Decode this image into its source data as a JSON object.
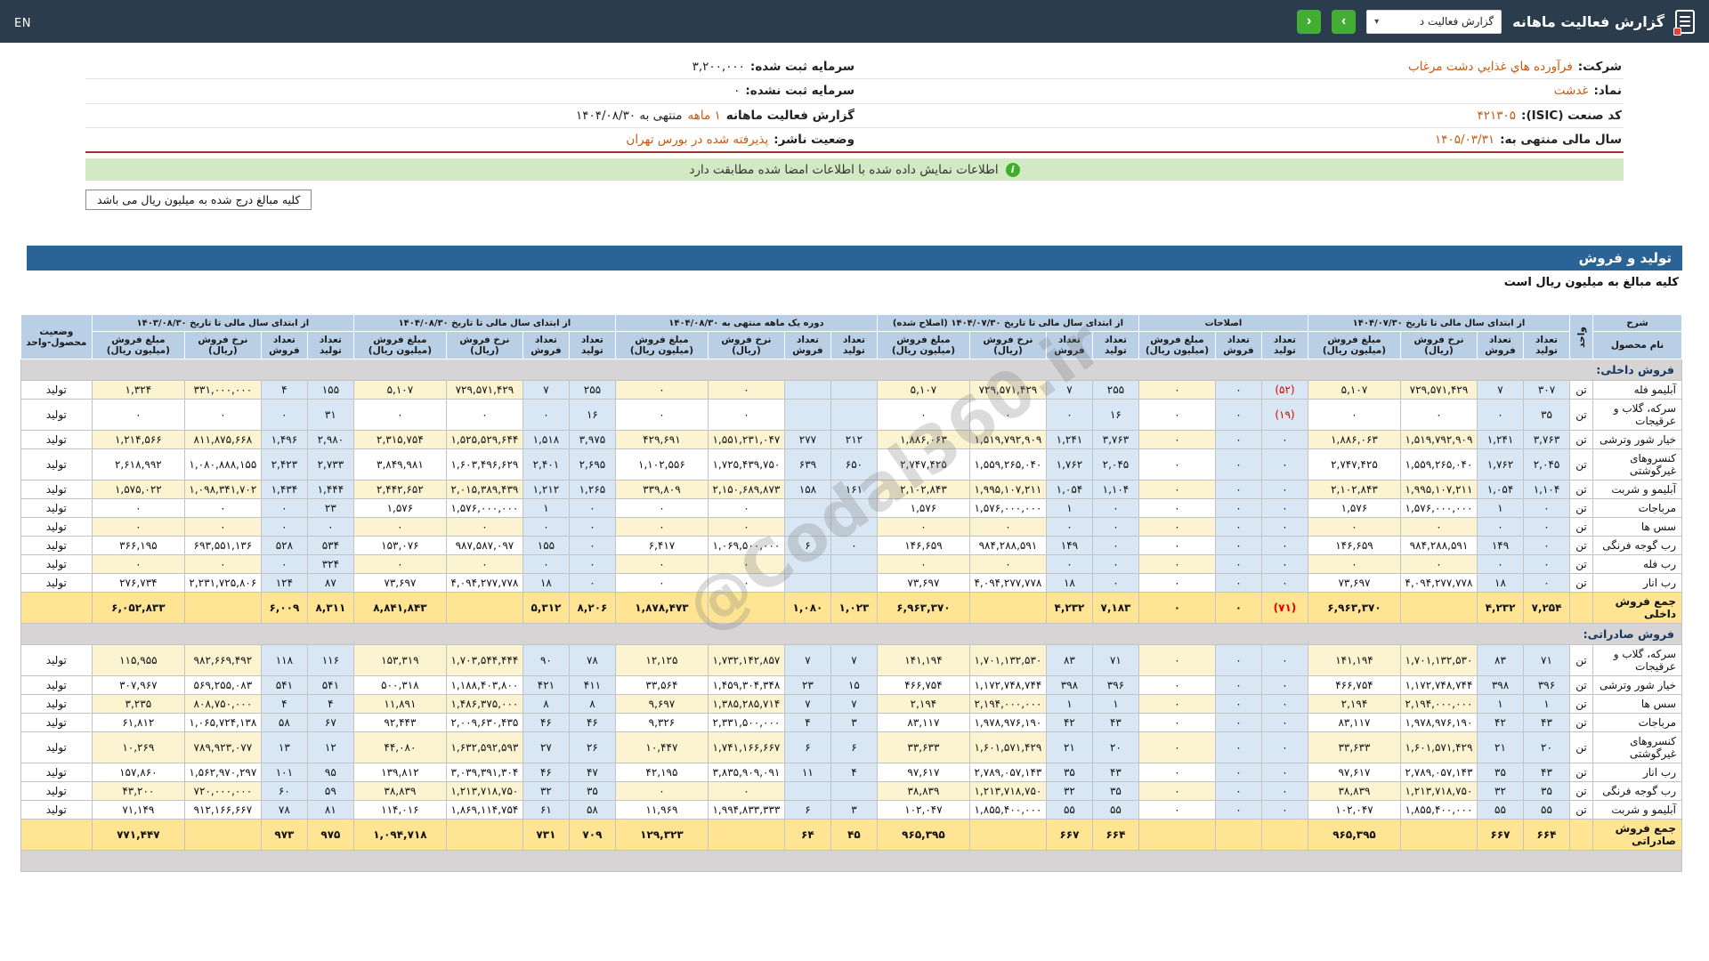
{
  "topbar": {
    "title": "گزارش فعالیت ماهانه",
    "dropdown_value": "گزارش فعالیت د",
    "next_label": "›",
    "prev_label": "‹",
    "lang_label": "EN"
  },
  "info": {
    "company_label": "شرکت:",
    "company": "فرآورده هاي غذايي دشت مرغاب",
    "symbol_label": "نماد:",
    "symbol": "غدشت",
    "isic_label": "کد صنعت (ISIC):",
    "isic": "۴۲۱۳۰۵",
    "fiscal_label": "سال مالی منتهی به:",
    "fiscal": "۱۴۰۵/۰۳/۳۱",
    "capital_reg_label": "سرمایه ثبت شده:",
    "capital_reg": "۳,۲۰۰,۰۰۰",
    "capital_unreg_label": "سرمایه ثبت نشده:",
    "capital_unreg": "۰",
    "report_label": "گزارش فعالیت ماهانه",
    "report_period": "۱ ماهه",
    "report_suffix": "منتهی به ۱۴۰۴/۰۸/۳۰",
    "issuer_label": "وضعیت ناشر:",
    "issuer": "پذیرفته شده در بورس تهران"
  },
  "banner": {
    "text": "اطلاعات نمایش داده شده با اطلاعات امضا شده مطابقت دارد"
  },
  "note": {
    "text": "کلیه مبالغ درج شده به میلیون ریال می باشد"
  },
  "watermark": "@Codal360.ir",
  "table": {
    "title": "تولید و فروش",
    "subtitle": "کلیه مبالغ به میلیون ریال است",
    "header": {
      "desc": "شرح",
      "product": "نام محصول",
      "unit": "واحد",
      "status": "وضعیت محصول-واحد",
      "count_produced": "تعداد تولید",
      "count_sold": "تعداد فروش",
      "rate": "نرخ فروش (ریال)",
      "amount": "مبلغ فروش (میلیون ریال)",
      "groups": [
        {
          "key": "g1",
          "label": "از ابتدای سال مالی تا تاریخ ۱۴۰۴/۰۷/۳۰",
          "cols": 4
        },
        {
          "key": "adj",
          "label": "اصلاحات",
          "cols": 3
        },
        {
          "key": "g3",
          "label": "از ابتدای سال مالی تا تاریخ ۱۴۰۴/۰۷/۳۰ (اصلاح شده)",
          "cols": 4
        },
        {
          "key": "g4",
          "label": "دوره یک ماهه منتهی به ۱۴۰۴/۰۸/۳۰",
          "cols": 4
        },
        {
          "key": "g5",
          "label": "از ابتدای سال مالی تا تاریخ ۱۴۰۴/۰۸/۳۰",
          "cols": 4
        },
        {
          "key": "g6",
          "label": "از ابتدای سال مالی تا تاریخ ۱۴۰۳/۰۸/۳۰",
          "cols": 4
        }
      ]
    },
    "rows": [
      {
        "type": "section",
        "name": "فروش داخلی:"
      },
      {
        "type": "data",
        "name": "آبلیمو فله",
        "unit": "تن",
        "status": "تولید",
        "g1": [
          "۳۰۷",
          "۷",
          "۷۲۹,۵۷۱,۴۲۹",
          "۵,۱۰۷"
        ],
        "adj": [
          "(۵۲)",
          "۰",
          "۰"
        ],
        "g3": [
          "۲۵۵",
          "۷",
          "۷۲۹,۵۷۱,۴۲۹",
          "۵,۱۰۷"
        ],
        "g4": [
          "",
          "",
          "۰",
          "۰"
        ],
        "g5": [
          "۲۵۵",
          "۷",
          "۷۲۹,۵۷۱,۴۲۹",
          "۵,۱۰۷"
        ],
        "g6": [
          "۱۵۵",
          "۴",
          "۳۳۱,۰۰۰,۰۰۰",
          "۱,۳۲۴"
        ]
      },
      {
        "type": "data",
        "name": "سرکه، گلاب و عرقیجات",
        "unit": "تن",
        "status": "تولید",
        "g1": [
          "۳۵",
          "۰",
          "۰",
          "۰"
        ],
        "adj": [
          "(۱۹)",
          "۰",
          "۰"
        ],
        "g3": [
          "۱۶",
          "۰",
          "۰",
          "۰"
        ],
        "g4": [
          "",
          "",
          "۰",
          "۰"
        ],
        "g5": [
          "۱۶",
          "۰",
          "۰",
          "۰"
        ],
        "g6": [
          "۳۱",
          "۰",
          "۰",
          "۰"
        ]
      },
      {
        "type": "data",
        "name": "خیار شور وترشی",
        "unit": "تن",
        "status": "تولید",
        "g1": [
          "۳,۷۶۳",
          "۱,۲۴۱",
          "۱,۵۱۹,۷۹۲,۹۰۹",
          "۱,۸۸۶,۰۶۳"
        ],
        "adj": [
          "۰",
          "۰",
          "۰"
        ],
        "g3": [
          "۳,۷۶۳",
          "۱,۲۴۱",
          "۱,۵۱۹,۷۹۲,۹۰۹",
          "۱,۸۸۶,۰۶۳"
        ],
        "g4": [
          "۲۱۲",
          "۲۷۷",
          "۱,۵۵۱,۲۳۱,۰۴۷",
          "۴۲۹,۶۹۱"
        ],
        "g5": [
          "۳,۹۷۵",
          "۱,۵۱۸",
          "۱,۵۲۵,۵۲۹,۶۴۴",
          "۲,۳۱۵,۷۵۴"
        ],
        "g6": [
          "۲,۹۸۰",
          "۱,۴۹۶",
          "۸۱۱,۸۷۵,۶۶۸",
          "۱,۲۱۴,۵۶۶"
        ]
      },
      {
        "type": "data",
        "name": "کنسروهای غیرگوشتی",
        "unit": "تن",
        "status": "تولید",
        "g1": [
          "۲,۰۴۵",
          "۱,۷۶۲",
          "۱,۵۵۹,۲۶۵,۰۴۰",
          "۲,۷۴۷,۴۲۵"
        ],
        "adj": [
          "۰",
          "۰",
          "۰"
        ],
        "g3": [
          "۲,۰۴۵",
          "۱,۷۶۲",
          "۱,۵۵۹,۲۶۵,۰۴۰",
          "۲,۷۴۷,۴۲۵"
        ],
        "g4": [
          "۶۵۰",
          "۶۳۹",
          "۱,۷۲۵,۴۳۹,۷۵۰",
          "۱,۱۰۲,۵۵۶"
        ],
        "g5": [
          "۲,۶۹۵",
          "۲,۴۰۱",
          "۱,۶۰۳,۴۹۶,۶۲۹",
          "۳,۸۴۹,۹۸۱"
        ],
        "g6": [
          "۲,۷۳۳",
          "۲,۴۲۳",
          "۱,۰۸۰,۸۸۸,۱۵۵",
          "۲,۶۱۸,۹۹۲"
        ]
      },
      {
        "type": "data",
        "name": "آبلیمو و شربت",
        "unit": "تن",
        "status": "تولید",
        "g1": [
          "۱,۱۰۴",
          "۱,۰۵۴",
          "۱,۹۹۵,۱۰۷,۲۱۱",
          "۲,۱۰۲,۸۴۳"
        ],
        "adj": [
          "۰",
          "۰",
          "۰"
        ],
        "g3": [
          "۱,۱۰۴",
          "۱,۰۵۴",
          "۱,۹۹۵,۱۰۷,۲۱۱",
          "۲,۱۰۲,۸۴۳"
        ],
        "g4": [
          "۱۶۱",
          "۱۵۸",
          "۲,۱۵۰,۶۸۹,۸۷۳",
          "۳۳۹,۸۰۹"
        ],
        "g5": [
          "۱,۲۶۵",
          "۱,۲۱۲",
          "۲,۰۱۵,۳۸۹,۴۳۹",
          "۲,۴۴۲,۶۵۲"
        ],
        "g6": [
          "۱,۴۴۴",
          "۱,۴۳۴",
          "۱,۰۹۸,۳۴۱,۷۰۲",
          "۱,۵۷۵,۰۲۲"
        ]
      },
      {
        "type": "data",
        "name": "مرباجات",
        "unit": "تن",
        "status": "تولید",
        "g1": [
          "۰",
          "۱",
          "۱,۵۷۶,۰۰۰,۰۰۰",
          "۱,۵۷۶"
        ],
        "adj": [
          "۰",
          "۰",
          "۰"
        ],
        "g3": [
          "۰",
          "۱",
          "۱,۵۷۶,۰۰۰,۰۰۰",
          "۱,۵۷۶"
        ],
        "g4": [
          "",
          "",
          "۰",
          "۰"
        ],
        "g5": [
          "۰",
          "۱",
          "۱,۵۷۶,۰۰۰,۰۰۰",
          "۱,۵۷۶"
        ],
        "g6": [
          "۲۳",
          "۰",
          "۰",
          "۰"
        ]
      },
      {
        "type": "data",
        "name": "سس ها",
        "unit": "تن",
        "status": "تولید",
        "g1": [
          "۰",
          "۰",
          "۰",
          "۰"
        ],
        "adj": [
          "۰",
          "۰",
          "۰"
        ],
        "g3": [
          "۰",
          "۰",
          "۰",
          "۰"
        ],
        "g4": [
          "",
          "",
          "۰",
          "۰"
        ],
        "g5": [
          "۰",
          "۰",
          "۰",
          "۰"
        ],
        "g6": [
          "۰",
          "۰",
          "۰",
          "۰"
        ]
      },
      {
        "type": "data",
        "name": "رب گوجه فرنگی",
        "unit": "تن",
        "status": "تولید",
        "g1": [
          "۰",
          "۱۴۹",
          "۹۸۴,۲۸۸,۵۹۱",
          "۱۴۶,۶۵۹"
        ],
        "adj": [
          "۰",
          "۰",
          "۰"
        ],
        "g3": [
          "۰",
          "۱۴۹",
          "۹۸۴,۲۸۸,۵۹۱",
          "۱۴۶,۶۵۹"
        ],
        "g4": [
          "۰",
          "۶",
          "۱,۰۶۹,۵۰۰,۰۰۰",
          "۶,۴۱۷"
        ],
        "g5": [
          "۰",
          "۱۵۵",
          "۹۸۷,۵۸۷,۰۹۷",
          "۱۵۳,۰۷۶"
        ],
        "g6": [
          "۵۳۴",
          "۵۲۸",
          "۶۹۳,۵۵۱,۱۳۶",
          "۳۶۶,۱۹۵"
        ]
      },
      {
        "type": "data",
        "name": "رب فله",
        "unit": "تن",
        "status": "تولید",
        "g1": [
          "۰",
          "۰",
          "۰",
          "۰"
        ],
        "adj": [
          "۰",
          "۰",
          "۰"
        ],
        "g3": [
          "۰",
          "۰",
          "۰",
          "۰"
        ],
        "g4": [
          "",
          "",
          "۰",
          "۰"
        ],
        "g5": [
          "۰",
          "۰",
          "۰",
          "۰"
        ],
        "g6": [
          "۳۲۴",
          "۰",
          "۰",
          "۰"
        ]
      },
      {
        "type": "data",
        "name": "رب انار",
        "unit": "تن",
        "status": "تولید",
        "g1": [
          "۰",
          "۱۸",
          "۴,۰۹۴,۲۷۷,۷۷۸",
          "۷۳,۶۹۷"
        ],
        "adj": [
          "۰",
          "۰",
          "۰"
        ],
        "g3": [
          "۰",
          "۱۸",
          "۴,۰۹۴,۲۷۷,۷۷۸",
          "۷۳,۶۹۷"
        ],
        "g4": [
          "",
          "",
          "۰",
          "۰"
        ],
        "g5": [
          "۰",
          "۱۸",
          "۴,۰۹۴,۲۷۷,۷۷۸",
          "۷۳,۶۹۷"
        ],
        "g6": [
          "۸۷",
          "۱۲۴",
          "۲,۲۳۱,۷۲۵,۸۰۶",
          "۲۷۶,۷۳۴"
        ]
      },
      {
        "type": "total",
        "name": "جمع فروش داخلی",
        "unit": "",
        "status": "",
        "g1": [
          "۷,۲۵۴",
          "۴,۲۳۲",
          "",
          "۶,۹۶۳,۳۷۰"
        ],
        "adj": [
          "(۷۱)",
          "۰",
          "۰"
        ],
        "g3": [
          "۷,۱۸۳",
          "۴,۲۳۲",
          "",
          "۶,۹۶۳,۳۷۰"
        ],
        "g4": [
          "۱,۰۲۳",
          "۱,۰۸۰",
          "",
          "۱,۸۷۸,۴۷۳"
        ],
        "g5": [
          "۸,۲۰۶",
          "۵,۳۱۲",
          "",
          "۸,۸۴۱,۸۴۳"
        ],
        "g6": [
          "۸,۳۱۱",
          "۶,۰۰۹",
          "",
          "۶,۰۵۲,۸۳۳"
        ]
      },
      {
        "type": "section",
        "name": "فروش صادراتی:"
      },
      {
        "type": "data",
        "name": "سرکه، گلاب و عرقیجات",
        "unit": "تن",
        "status": "تولید",
        "g1": [
          "۷۱",
          "۸۳",
          "۱,۷۰۱,۱۳۲,۵۳۰",
          "۱۴۱,۱۹۴"
        ],
        "adj": [
          "۰",
          "۰",
          "۰"
        ],
        "g3": [
          "۷۱",
          "۸۳",
          "۱,۷۰۱,۱۳۲,۵۳۰",
          "۱۴۱,۱۹۴"
        ],
        "g4": [
          "۷",
          "۷",
          "۱,۷۳۲,۱۴۲,۸۵۷",
          "۱۲,۱۲۵"
        ],
        "g5": [
          "۷۸",
          "۹۰",
          "۱,۷۰۳,۵۴۴,۴۴۴",
          "۱۵۳,۳۱۹"
        ],
        "g6": [
          "۱۱۶",
          "۱۱۸",
          "۹۸۲,۶۶۹,۴۹۲",
          "۱۱۵,۹۵۵"
        ]
      },
      {
        "type": "data",
        "name": "خیار شور وترشی",
        "unit": "تن",
        "status": "تولید",
        "g1": [
          "۳۹۶",
          "۳۹۸",
          "۱,۱۷۲,۷۴۸,۷۴۴",
          "۴۶۶,۷۵۴"
        ],
        "adj": [
          "۰",
          "۰",
          "۰"
        ],
        "g3": [
          "۳۹۶",
          "۳۹۸",
          "۱,۱۷۲,۷۴۸,۷۴۴",
          "۴۶۶,۷۵۴"
        ],
        "g4": [
          "۱۵",
          "۲۳",
          "۱,۴۵۹,۳۰۴,۳۴۸",
          "۳۳,۵۶۴"
        ],
        "g5": [
          "۴۱۱",
          "۴۲۱",
          "۱,۱۸۸,۴۰۳,۸۰۰",
          "۵۰۰,۳۱۸"
        ],
        "g6": [
          "۵۴۱",
          "۵۴۱",
          "۵۶۹,۲۵۵,۰۸۳",
          "۳۰۷,۹۶۷"
        ]
      },
      {
        "type": "data",
        "name": "سس ها",
        "unit": "تن",
        "status": "تولید",
        "g1": [
          "۱",
          "۱",
          "۲,۱۹۴,۰۰۰,۰۰۰",
          "۲,۱۹۴"
        ],
        "adj": [
          "۰",
          "۰",
          "۰"
        ],
        "g3": [
          "۱",
          "۱",
          "۲,۱۹۴,۰۰۰,۰۰۰",
          "۲,۱۹۴"
        ],
        "g4": [
          "۷",
          "۷",
          "۱,۳۸۵,۲۸۵,۷۱۴",
          "۹,۶۹۷"
        ],
        "g5": [
          "۸",
          "۸",
          "۱,۴۸۶,۳۷۵,۰۰۰",
          "۱۱,۸۹۱"
        ],
        "g6": [
          "۴",
          "۴",
          "۸۰۸,۷۵۰,۰۰۰",
          "۳,۲۳۵"
        ]
      },
      {
        "type": "data",
        "name": "مرباجات",
        "unit": "تن",
        "status": "تولید",
        "g1": [
          "۴۳",
          "۴۲",
          "۱,۹۷۸,۹۷۶,۱۹۰",
          "۸۳,۱۱۷"
        ],
        "adj": [
          "۰",
          "۰",
          "۰"
        ],
        "g3": [
          "۴۳",
          "۴۲",
          "۱,۹۷۸,۹۷۶,۱۹۰",
          "۸۳,۱۱۷"
        ],
        "g4": [
          "۳",
          "۴",
          "۲,۳۳۱,۵۰۰,۰۰۰",
          "۹,۳۲۶"
        ],
        "g5": [
          "۴۶",
          "۴۶",
          "۲,۰۰۹,۶۳۰,۴۳۵",
          "۹۲,۴۴۳"
        ],
        "g6": [
          "۶۷",
          "۵۸",
          "۱,۰۶۵,۷۲۴,۱۳۸",
          "۶۱,۸۱۲"
        ]
      },
      {
        "type": "data",
        "name": "کنسروهای غیرگوشتی",
        "unit": "تن",
        "status": "تولید",
        "g1": [
          "۲۰",
          "۲۱",
          "۱,۶۰۱,۵۷۱,۴۲۹",
          "۳۳,۶۳۳"
        ],
        "adj": [
          "۰",
          "۰",
          "۰"
        ],
        "g3": [
          "۲۰",
          "۲۱",
          "۱,۶۰۱,۵۷۱,۴۲۹",
          "۳۳,۶۳۳"
        ],
        "g4": [
          "۶",
          "۶",
          "۱,۷۴۱,۱۶۶,۶۶۷",
          "۱۰,۴۴۷"
        ],
        "g5": [
          "۲۶",
          "۲۷",
          "۱,۶۳۲,۵۹۲,۵۹۳",
          "۴۴,۰۸۰"
        ],
        "g6": [
          "۱۲",
          "۱۳",
          "۷۸۹,۹۲۳,۰۷۷",
          "۱۰,۲۶۹"
        ]
      },
      {
        "type": "data",
        "name": "رب انار",
        "unit": "تن",
        "status": "تولید",
        "g1": [
          "۴۳",
          "۳۵",
          "۲,۷۸۹,۰۵۷,۱۴۳",
          "۹۷,۶۱۷"
        ],
        "adj": [
          "۰",
          "۰",
          "۰"
        ],
        "g3": [
          "۴۳",
          "۳۵",
          "۲,۷۸۹,۰۵۷,۱۴۳",
          "۹۷,۶۱۷"
        ],
        "g4": [
          "۴",
          "۱۱",
          "۳,۸۳۵,۹۰۹,۰۹۱",
          "۴۲,۱۹۵"
        ],
        "g5": [
          "۴۷",
          "۴۶",
          "۳,۰۳۹,۳۹۱,۳۰۴",
          "۱۳۹,۸۱۲"
        ],
        "g6": [
          "۹۵",
          "۱۰۱",
          "۱,۵۶۲,۹۷۰,۲۹۷",
          "۱۵۷,۸۶۰"
        ]
      },
      {
        "type": "data",
        "name": "رب گوجه فرنگی",
        "unit": "تن",
        "status": "تولید",
        "g1": [
          "۳۵",
          "۳۲",
          "۱,۲۱۳,۷۱۸,۷۵۰",
          "۳۸,۸۳۹"
        ],
        "adj": [
          "۰",
          "۰",
          "۰"
        ],
        "g3": [
          "۳۵",
          "۳۲",
          "۱,۲۱۳,۷۱۸,۷۵۰",
          "۳۸,۸۳۹"
        ],
        "g4": [
          "",
          "",
          "۰",
          "۰"
        ],
        "g5": [
          "۳۵",
          "۳۲",
          "۱,۲۱۳,۷۱۸,۷۵۰",
          "۳۸,۸۳۹"
        ],
        "g6": [
          "۵۹",
          "۶۰",
          "۷۲۰,۰۰۰,۰۰۰",
          "۴۳,۲۰۰"
        ]
      },
      {
        "type": "data",
        "name": "آبلیمو و شربت",
        "unit": "تن",
        "status": "تولید",
        "g1": [
          "۵۵",
          "۵۵",
          "۱,۸۵۵,۴۰۰,۰۰۰",
          "۱۰۲,۰۴۷"
        ],
        "adj": [
          "۰",
          "۰",
          "۰"
        ],
        "g3": [
          "۵۵",
          "۵۵",
          "۱,۸۵۵,۴۰۰,۰۰۰",
          "۱۰۲,۰۴۷"
        ],
        "g4": [
          "۳",
          "۶",
          "۱,۹۹۴,۸۳۳,۳۳۳",
          "۱۱,۹۶۹"
        ],
        "g5": [
          "۵۸",
          "۶۱",
          "۱,۸۶۹,۱۱۴,۷۵۴",
          "۱۱۴,۰۱۶"
        ],
        "g6": [
          "۸۱",
          "۷۸",
          "۹۱۲,۱۶۶,۶۶۷",
          "۷۱,۱۴۹"
        ]
      },
      {
        "type": "total",
        "name": "جمع فروش صادراتی",
        "unit": "",
        "status": "",
        "g1": [
          "۶۶۴",
          "۶۶۷",
          "",
          "۹۶۵,۳۹۵"
        ],
        "adj": [
          "",
          "",
          ""
        ],
        "g3": [
          "۶۶۴",
          "۶۶۷",
          "",
          "۹۶۵,۳۹۵"
        ],
        "g4": [
          "۴۵",
          "۶۴",
          "",
          "۱۲۹,۳۲۳"
        ],
        "g5": [
          "۷۰۹",
          "۷۳۱",
          "",
          "۱,۰۹۴,۷۱۸"
        ],
        "g6": [
          "۹۷۵",
          "۹۷۳",
          "",
          "۷۷۱,۴۴۷"
        ]
      },
      {
        "type": "section",
        "name": ""
      }
    ]
  }
}
